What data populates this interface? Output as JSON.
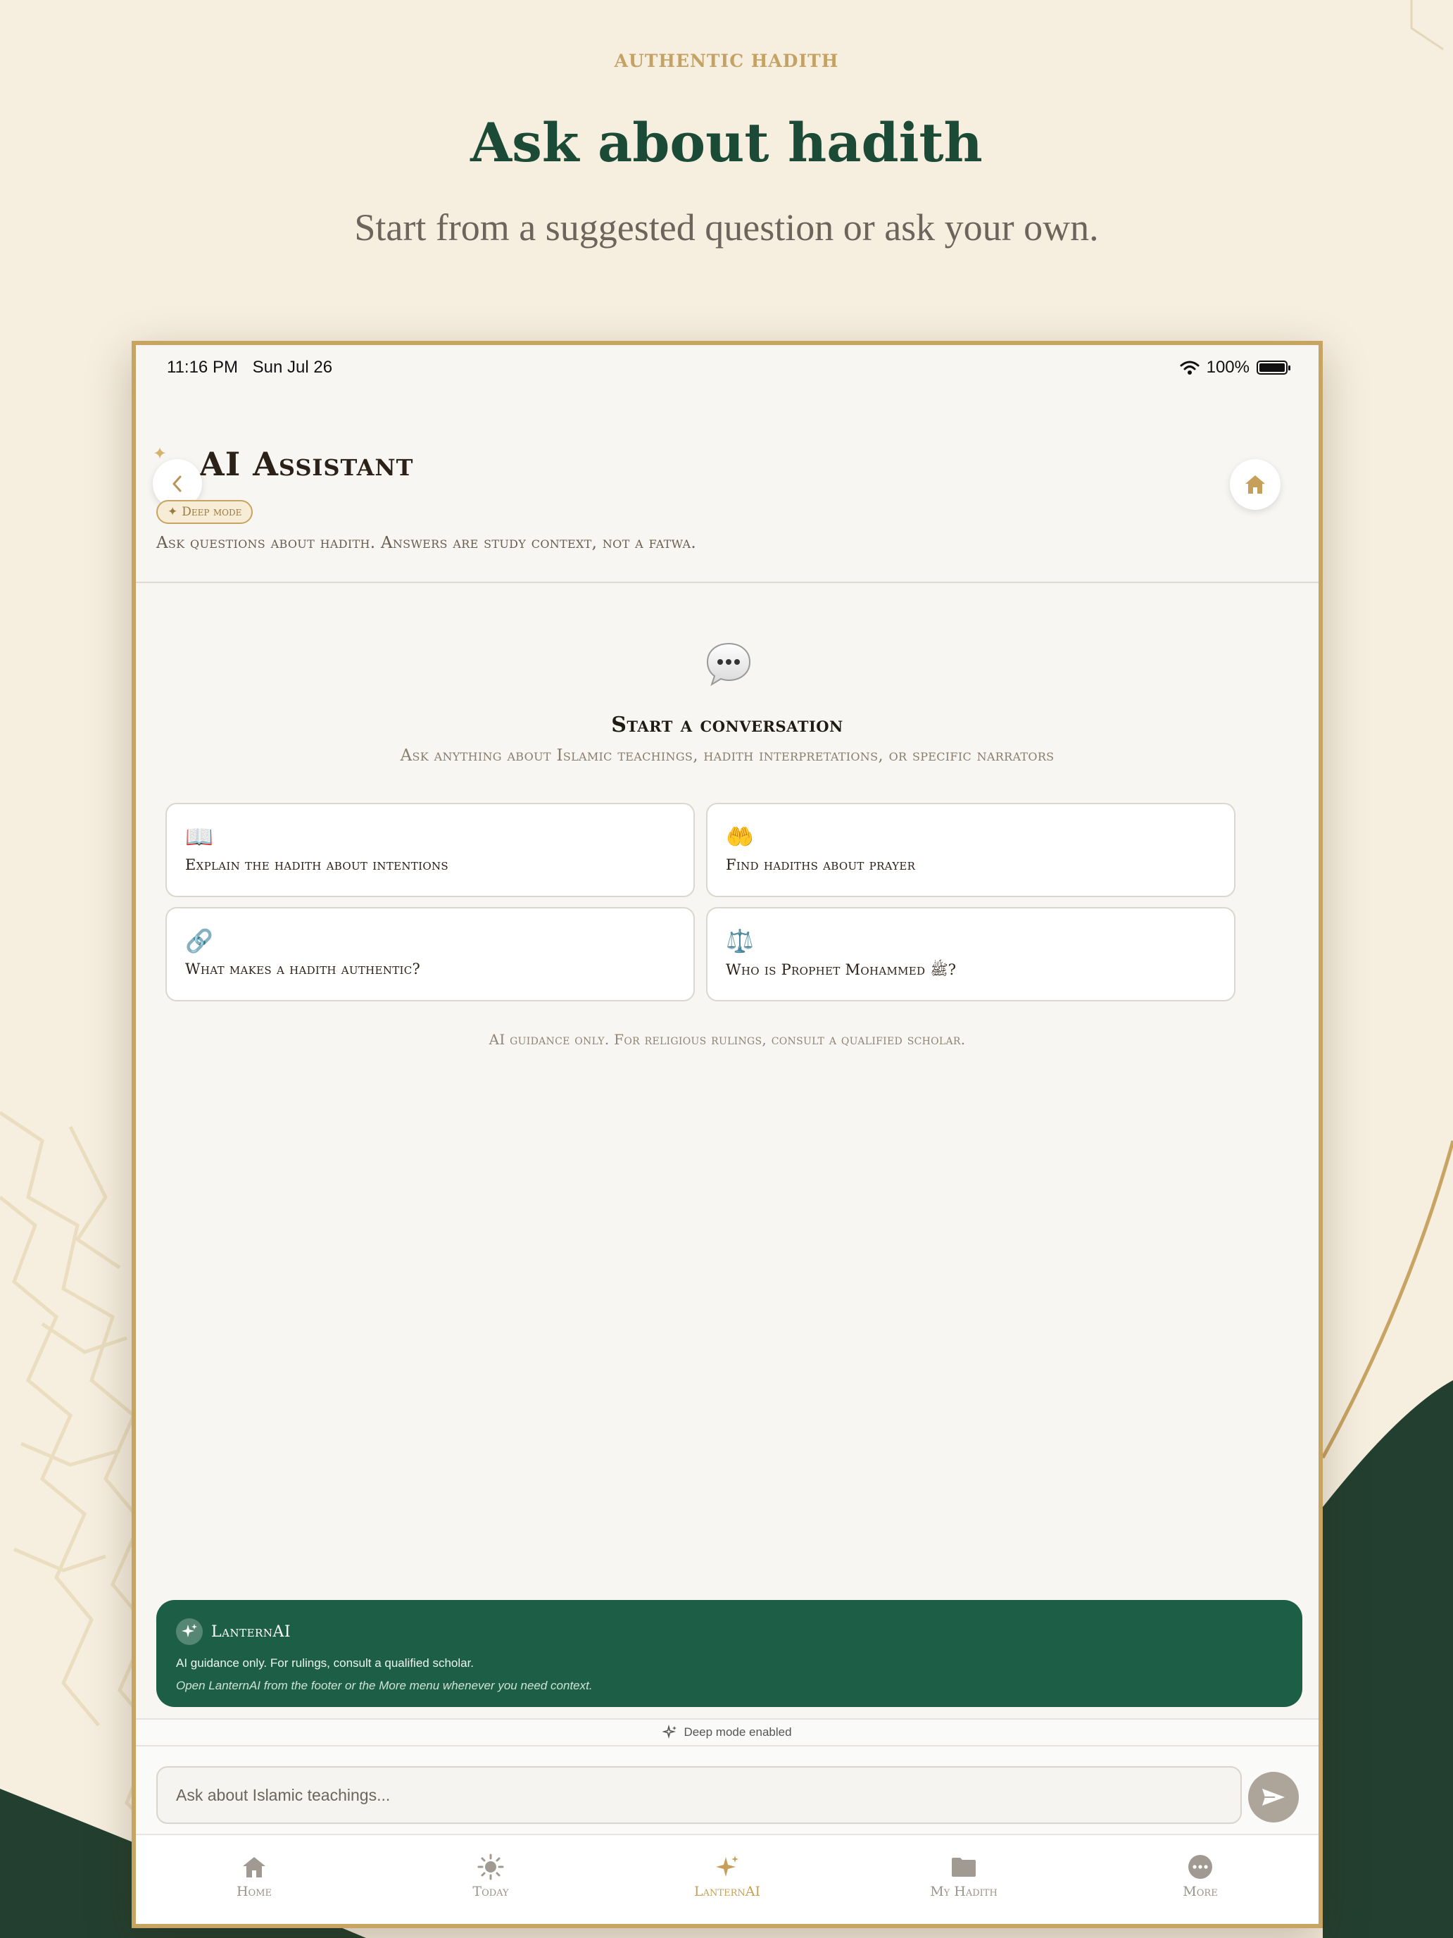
{
  "marketing": {
    "eyebrow": "AUTHENTIC HADITH",
    "title": "Ask about hadith",
    "subtitle": "Start from a suggested question or ask your own."
  },
  "status_bar": {
    "time": "11:16 PM",
    "date": "Sun Jul 26",
    "battery": "100%",
    "battery_level": 1.0
  },
  "header": {
    "title": "AI Assistant",
    "badge": "Deep mode",
    "subtitle": "Ask questions about hadith. Answers are study context, not a fatwa."
  },
  "empty_state": {
    "title": "Start a conversation",
    "subtitle": "Ask anything about Islamic teachings, hadith interpretations, or specific narrators",
    "footnote": "AI guidance only. For religious rulings, consult a qualified scholar."
  },
  "suggestions": [
    {
      "icon": "📖",
      "icon_name": "open-book-icon",
      "text": "Explain the hadith about intentions"
    },
    {
      "icon": "🤲",
      "icon_name": "palms-up-icon",
      "text": "Find hadiths about prayer"
    },
    {
      "icon": "🔗",
      "icon_name": "link-icon",
      "text": "What makes a hadith authentic?"
    },
    {
      "icon": "⚖️",
      "icon_name": "scales-icon",
      "text": "Who is Prophet Mohammed ﷺ?"
    }
  ],
  "lantern_card": {
    "name": "LanternAI",
    "line1": "AI guidance only. For rulings, consult a qualified scholar.",
    "line2": "Open LanternAI from the footer or the More menu whenever you need context."
  },
  "deep_mode_row": "Deep mode enabled",
  "input": {
    "placeholder": "Ask about Islamic teachings...",
    "value": ""
  },
  "tabs": [
    {
      "label": "Home",
      "icon": "home-icon",
      "active": false
    },
    {
      "label": "Today",
      "icon": "sun-icon",
      "active": false
    },
    {
      "label": "LanternAI",
      "icon": "sparkle-icon",
      "active": true
    },
    {
      "label": "My Hadith",
      "icon": "folder-icon",
      "active": false
    },
    {
      "label": "More",
      "icon": "more-icon",
      "active": false
    }
  ],
  "colors": {
    "accent_gold": "#c8a463",
    "brand_green": "#1d5f46",
    "title_green": "#1b4a36",
    "page_bg": "#f6eedf"
  }
}
